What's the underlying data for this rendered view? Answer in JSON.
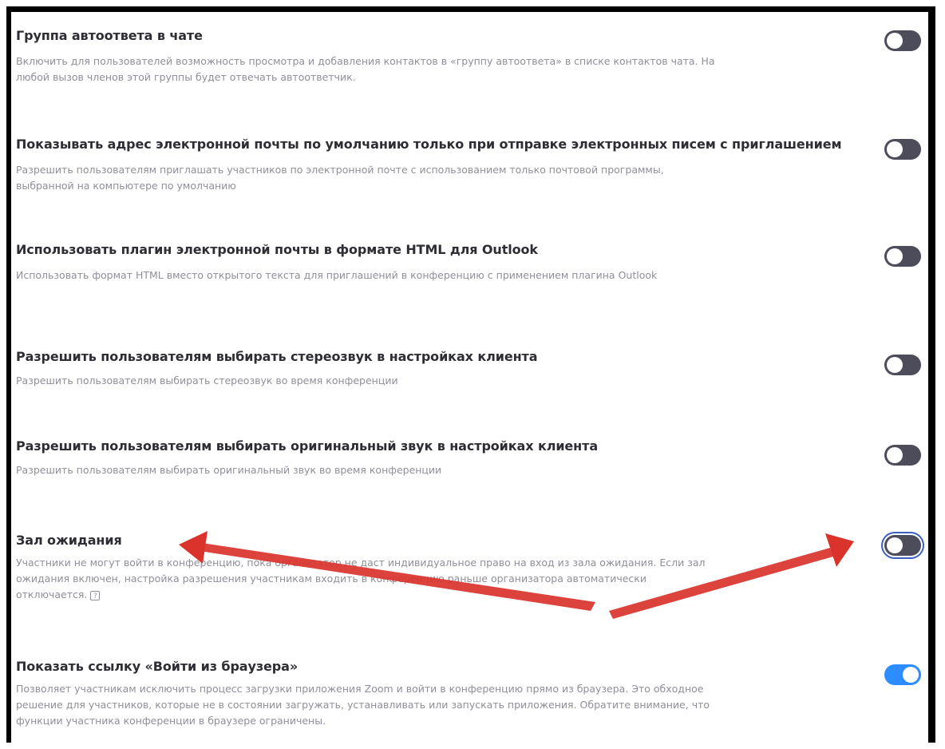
{
  "settings": [
    {
      "title": "Группа автоответа в чате",
      "description": "Включить для пользователей возможность просмотра и добавления контактов в «группу автоответа» в списке контактов чата. На любой вызов членов этой группы будет отвечать автоответчик.",
      "enabled": false
    },
    {
      "title": "Показывать адрес электронной почты по умолчанию только при отправке электронных писем с приглашением",
      "description": "Разрешить пользователям приглашать участников по электронной почте с использованием только почтовой программы, выбранной на компьютере по умолчанию",
      "enabled": false
    },
    {
      "title": "Использовать плагин электронной почты в формате HTML для Outlook",
      "description": "Использовать формат HTML вместо открытого текста для приглашений в конференцию с применением плагина Outlook",
      "enabled": false
    },
    {
      "title": "Разрешить пользователям выбирать стереозвук в настройках клиента",
      "description": "Разрешить пользователям выбирать стереозвук во время конференции",
      "enabled": false
    },
    {
      "title": "Разрешить пользователям выбирать оригинальный звук в настройках клиента",
      "description": "Разрешить пользователям выбирать оригинальный звук во время конференции",
      "enabled": false
    },
    {
      "title": "Зал ожидания",
      "description": "Участники не могут войти в конференцию, пока организатор не даст индивидуальное право на вход из зала ожидания. Если зал ожидания включен, настройка разрешения участникам входить в конференцию раньше организатора автоматически отключается.",
      "enabled": false
    },
    {
      "title": "Показать ссылку «Войти из браузера»",
      "description": "Позволяет участникам исключить процесс загрузки приложения Zoom и войти в конференцию прямо из браузера. Это обходное решение для участников, которые не в состоянии загружать, устанавливать или запускать приложения. Обратите внимание, что функции участника конференции в браузере ограничены.",
      "enabled": true
    }
  ],
  "help_icon_glyph": "?",
  "colors": {
    "toggle_off": "#4c4c5a",
    "toggle_on": "#2d8cff",
    "annotation_arrow": "#d9332b"
  },
  "icons": {
    "help": "help-icon",
    "arrow": "red-arrow-annotation"
  }
}
